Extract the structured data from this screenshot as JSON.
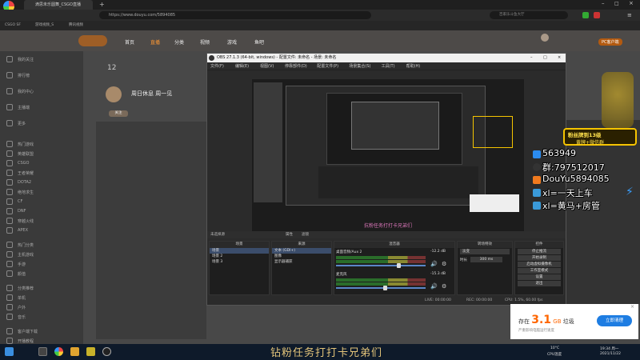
{
  "browser": {
    "tabs": [
      {
        "label": "滴思未乐圆舞_CSGO直播"
      },
      {
        "label": "无标题"
      }
    ],
    "address": "https://www.douyu.com/5894085",
    "search_placeholder": "百家乐斗鱼大厅",
    "bookmarks": [
      "CSGO SF",
      "游戏视频_S",
      "腾讯视频"
    ]
  },
  "douyu": {
    "nav": [
      "首页",
      "直播",
      "分类",
      "视频",
      "游戏",
      "鱼吧"
    ],
    "stats_count": "12",
    "streamer_title": "周日休息 周一见",
    "follow_label": "关注",
    "sidebar": [
      "我的关注",
      "排行榜",
      "我的中心",
      "主播端",
      "更多",
      "热门游戏",
      "英雄联盟",
      "CSGO",
      "王者荣耀",
      "DOTA2",
      "绝地求生",
      "CF",
      "DNF",
      "穿越火线",
      "APEX",
      "热门分类",
      "主机游戏",
      "手游",
      "颜值",
      "分类推荐",
      "单机",
      "户外",
      "音乐",
      "客户端下载",
      "开播教程"
    ],
    "right_badge": "PC客户端"
  },
  "obs": {
    "title": "OBS 27.1.3 (64-bit, windows) - 配置文件: 未命名 - 场景: 未命名",
    "menu": [
      "文件(F)",
      "编辑(E)",
      "视图(V)",
      "停靠部件(D)",
      "配置文件(P)",
      "场景集合(S)",
      "工具(T)",
      "帮助(H)"
    ],
    "scenes_label": "场景",
    "scenes": [
      "场景",
      "场景 2",
      "场景 3"
    ],
    "sources_label": "来源",
    "sources": [
      "文本 (GDI+)",
      "图像",
      "显示器捕获"
    ],
    "mixer_label": "混音器",
    "mixer_tracks": [
      {
        "name": "桌面音频/Aux 2",
        "db": "-12.2 dB",
        "level": 0.7
      },
      {
        "name": "麦克风",
        "db": "-15.3 dB",
        "level": 0.55
      }
    ],
    "transitions_label": "转场特效",
    "transition_type": "淡变",
    "duration_label": "时长",
    "duration_value": "300 ms",
    "controls_label": "控件",
    "controls": [
      "停止推流",
      "开始录制",
      "启动虚拟摄像机",
      "工作室模式",
      "设置",
      "退出"
    ],
    "no_source_label": "未选择源",
    "props_label": "属性",
    "filters_label": "滤镜",
    "status": {
      "live": "LIVE: 00:00:00",
      "rec": "REC: 00:00:00",
      "cpu": "CPU: 1.5%, 60.00 fps"
    },
    "preview_caption": "抗粉任务打打卡兄弟们"
  },
  "fan": {
    "header": "粉丝牌到13级",
    "subheader": "黄牌+微信群",
    "lines": [
      "563949",
      "群:797512017",
      "DouYu5894085",
      "xl=一天上车",
      "xl=黄马+房管"
    ]
  },
  "ad": {
    "text_prefix": "存在",
    "amount": "3.1",
    "unit": "GB",
    "suffix": "垃圾",
    "sub": "严重影响电脑运行速度",
    "button": "立即清理"
  },
  "subtitle": "钻粉任务打打卡兄弟们",
  "taskbar": {
    "weather": "10°C",
    "weather_sub": "CPU温度",
    "time": "19:34 周一",
    "date": "2021/11/22"
  },
  "colors": {
    "douyu_orange": "#ff7700",
    "fan_border": "#f5c400",
    "ad_blue": "#1e7de2"
  }
}
